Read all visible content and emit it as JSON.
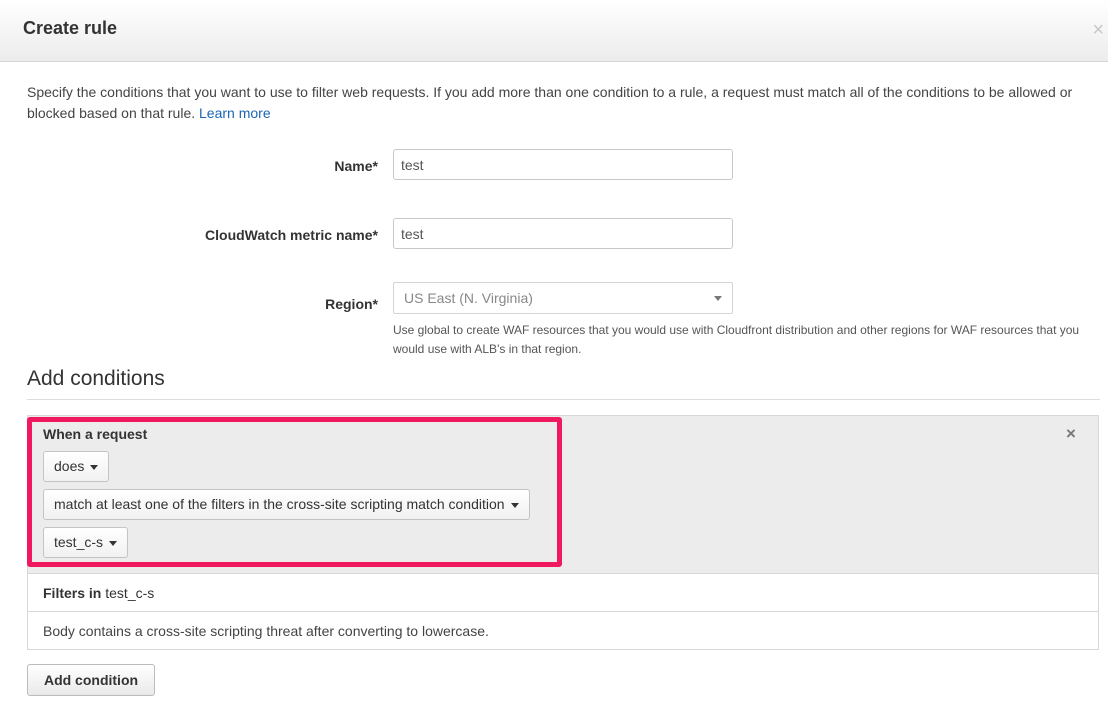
{
  "dialog": {
    "title": "Create rule",
    "close_symbol": "×",
    "intro_text": "Specify the conditions that you want to use to filter web requests. If you add more than one condition to a rule, a request must match all of the conditions to be allowed or blocked based on that rule.",
    "learn_more": "Learn more"
  },
  "form": {
    "name_label": "Name*",
    "name_value": "test",
    "metric_label": "CloudWatch metric name*",
    "metric_value": "test",
    "region_label": "Region*",
    "region_value": "US East (N. Virginia)",
    "region_help": "Use global to create WAF resources that you would use with Cloudfront distribution and other regions for WAF resources that you would use with ALB's in that region."
  },
  "conditions": {
    "section_title": "Add conditions",
    "when_label": "When a request",
    "remove_symbol": "×",
    "does_value": "does",
    "match_value": "match at least one of the filters in the cross-site scripting match condition",
    "condition_value": "test_c-s",
    "filters_label": "Filters in",
    "filters_condition": "test_c-s",
    "filter_description": "Body contains a cross-site scripting threat after converting to lowercase.",
    "add_button": "Add condition"
  },
  "colors": {
    "highlight": "#f0185f",
    "link": "#1a66b5"
  }
}
